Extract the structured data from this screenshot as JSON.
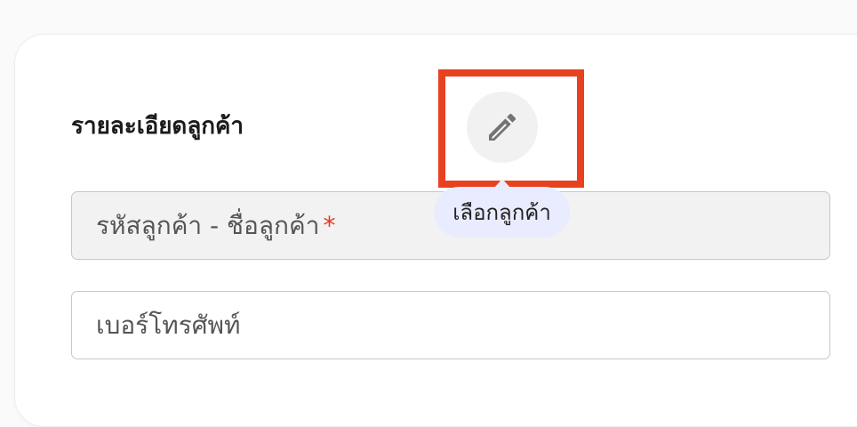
{
  "customer_section": {
    "title": "รายละเอียดลูกค้า",
    "edit_icon": "pencil-icon",
    "tooltip": "เลือกลูกค้า",
    "fields": {
      "customer": {
        "placeholder": "รหัสลูกค้า - ชื่อลูกค้า",
        "required_mark": "*"
      },
      "phone": {
        "placeholder": "เบอร์โทรศัพท์"
      }
    }
  },
  "colors": {
    "highlight": "#e8411f",
    "required": "#e53925",
    "tooltip_bg": "#e9ebff"
  }
}
